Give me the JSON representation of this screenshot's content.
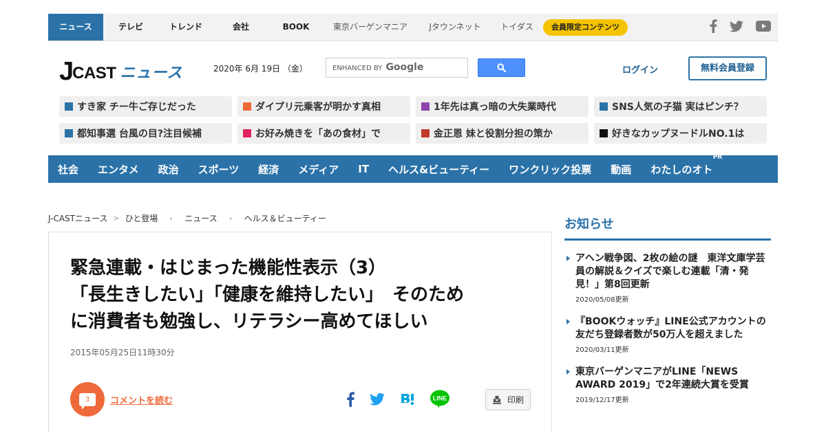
{
  "topnav": {
    "items": [
      {
        "label": "ニュース",
        "active": true
      },
      {
        "label": "テレビ"
      },
      {
        "label": "トレンド"
      },
      {
        "label": "会社"
      },
      {
        "label": "BOOK"
      },
      {
        "label": "東京バーゲンマニア"
      },
      {
        "label": "Jタウンネット"
      },
      {
        "label": "トイダス"
      }
    ],
    "member_badge": "会員限定コンテンツ",
    "social_icons": [
      "facebook-icon",
      "twitter-icon",
      "youtube-icon"
    ]
  },
  "header": {
    "logo_j": "J",
    "logo_cast": "CAST",
    "logo_news": "ニュース",
    "date": "2020年 6月 19日 （金）",
    "search_prefix": "ENHANCED BY",
    "search_brand": "Google",
    "login": "ログイン",
    "register": "無料会員登録"
  },
  "ticker": [
    {
      "label": "すき家 チー牛ご存じだった",
      "color": "#2b72a8"
    },
    {
      "label": "ダイプリ元乗客が明かす真相",
      "color": "#ef6a3a"
    },
    {
      "label": "1年先は真っ暗の大失業時代",
      "color": "#8e44ad"
    },
    {
      "label": "SNS人気の子猫 実はピンチ？",
      "color": "#2b72a8"
    },
    {
      "label": "都知事選 台風の目?注目候補",
      "color": "#2b72a8"
    },
    {
      "label": "お好み焼きを「あの食材」で",
      "color": "#e0245e"
    },
    {
      "label": "金正恩 妹と役割分担の策か",
      "color": "#c0392b"
    },
    {
      "label": "好きなカップヌードルNO.1は",
      "color": "#111111"
    }
  ],
  "categories": [
    {
      "label": "社会"
    },
    {
      "label": "エンタメ"
    },
    {
      "label": "政治"
    },
    {
      "label": "スポーツ"
    },
    {
      "label": "経済"
    },
    {
      "label": "メディア"
    },
    {
      "label": "IT"
    },
    {
      "label": "ヘルス&ビューティー"
    },
    {
      "label": "ワンクリック投票"
    },
    {
      "label": "動画"
    },
    {
      "label": "わたしのオト",
      "badge": "PR"
    }
  ],
  "breadcrumb": {
    "items": [
      "J-CASTニュース",
      "ひと登場",
      "ニュース",
      "ヘルス＆ビューティー"
    ],
    "separators": [
      ">",
      "・",
      "・"
    ]
  },
  "article": {
    "headline_lines": [
      "緊急連載・はじまった機能性表示（3）",
      "「長生きしたい」「健康を維持したい」　そのため",
      "に消費者も勉強し、リテラシー高めてほしい"
    ],
    "published": "2015年05月25日11時30分",
    "comment_count": "3",
    "comment_link": "コメントを読む",
    "share_icons": [
      "facebook-icon",
      "twitter-icon",
      "hatena-bookmark-icon",
      "line-icon"
    ],
    "print": "印刷"
  },
  "sidebar": {
    "title": "お知らせ",
    "items": [
      {
        "title": "アヘン戦争図、2枚の絵の謎　東洋文庫学芸員の解説＆クイズで楽しむ連載「清・発見！」第8回更新",
        "date": "2020/05/08更新"
      },
      {
        "title": "『BOOKウォッチ』LINE公式アカウントの友だち登録者数が50万人を超えました",
        "date": "2020/03/11更新"
      },
      {
        "title": "東京バーゲンマニアがLINE「NEWS AWARD 2019」で2年連続大賞を受賞",
        "date": "2019/12/17更新"
      }
    ]
  }
}
